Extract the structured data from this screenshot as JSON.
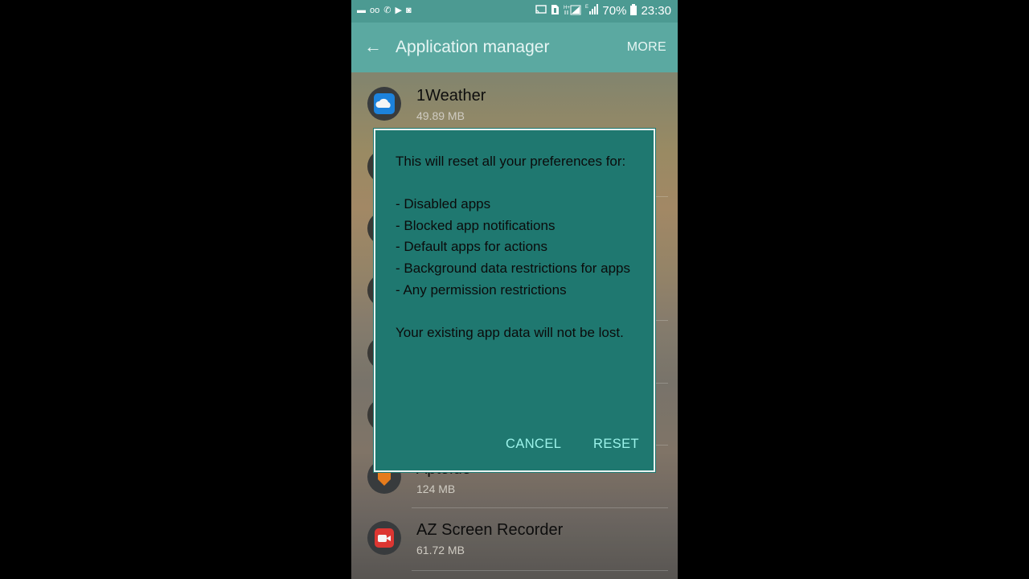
{
  "status_bar": {
    "icons": [
      "video-icon",
      "voicemail-icon",
      "wifi-calling-icon",
      "play-store-icon",
      "screenshot-icon",
      "cast-icon",
      "sim-icon",
      "hd-signal-icon",
      "signal-icon",
      "battery-icon"
    ],
    "left_glyphs": [
      "▬",
      "oo",
      "✆",
      "▶",
      "◙"
    ],
    "battery": "70%",
    "time": "23:30"
  },
  "app_bar": {
    "back_glyph": "←",
    "title": "Application manager",
    "more_label": "MORE"
  },
  "apps": [
    {
      "name": "1Weather",
      "size": "49.89 MB",
      "icon": "weather-icon",
      "color": "#1e88e5"
    },
    {
      "name": "Aptoide",
      "size": "124 MB",
      "icon": "aptoide-icon",
      "color": "#f0811e"
    },
    {
      "name": "AZ Screen Recorder",
      "size": "61.72 MB",
      "icon": "screen-recorder-icon",
      "color": "#e53935"
    }
  ],
  "dialog": {
    "message": "This will reset all your preferences for:\n\n- Disabled apps\n- Blocked app notifications\n- Default apps for actions\n- Background data restrictions for apps\n- Any permission restrictions\n\nYour existing app data will not be lost.",
    "cancel_label": "CANCEL",
    "reset_label": "RESET"
  },
  "colors": {
    "status_bar": "#4c9a92",
    "app_bar": "#5ba9a1",
    "dialog_bg": "#1f7870",
    "dialog_button": "#9cf3ea"
  }
}
